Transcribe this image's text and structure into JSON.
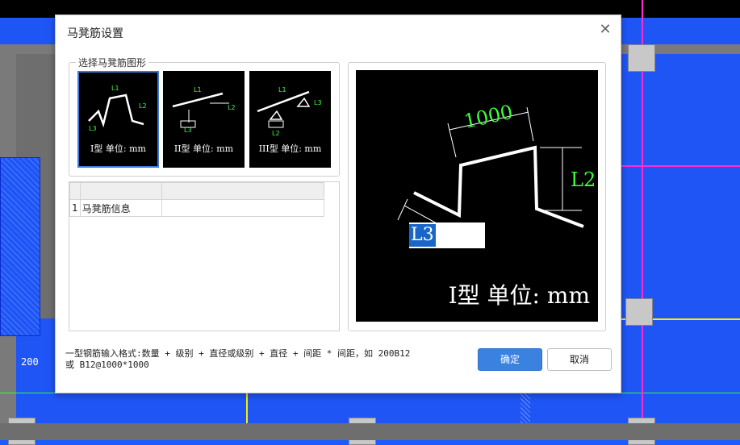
{
  "background": {
    "dim_label": "200",
    "colors": {
      "canvas": "#1f55f5",
      "magenta": "#ff2bd4",
      "yellow": "#f2f200",
      "green": "#33ff33"
    }
  },
  "dialog": {
    "title": "马凳筋设置",
    "close_icon": "close-icon",
    "group_label": "选择马凳筋图形",
    "thumbnails": [
      {
        "caption": "I型 单位: mm",
        "l1": "L1",
        "l2": "L2",
        "l3": "L3",
        "selected": true
      },
      {
        "caption": "II型 单位: mm",
        "l1": "L1",
        "l2": "L2",
        "l3": "L3",
        "selected": false
      },
      {
        "caption": "III型 单位: mm",
        "l1": "L1",
        "l2": "L2",
        "l3": "L3",
        "selected": false
      }
    ],
    "table": {
      "rows": [
        {
          "index": "1",
          "name": "马凳筋信息",
          "value": ""
        }
      ]
    },
    "preview": {
      "dim_top": "1000",
      "dim_right": "L2",
      "l3_label": "L3",
      "caption": "I型 单位: mm"
    },
    "note_line1": "一型钢筋输入格式:数量 + 级别 + 直径或级别 + 直径 + 间距 * 间距，如 200B12",
    "note_line2": "或 B12@1000*1000",
    "ok_label": "确定",
    "cancel_label": "取消"
  }
}
